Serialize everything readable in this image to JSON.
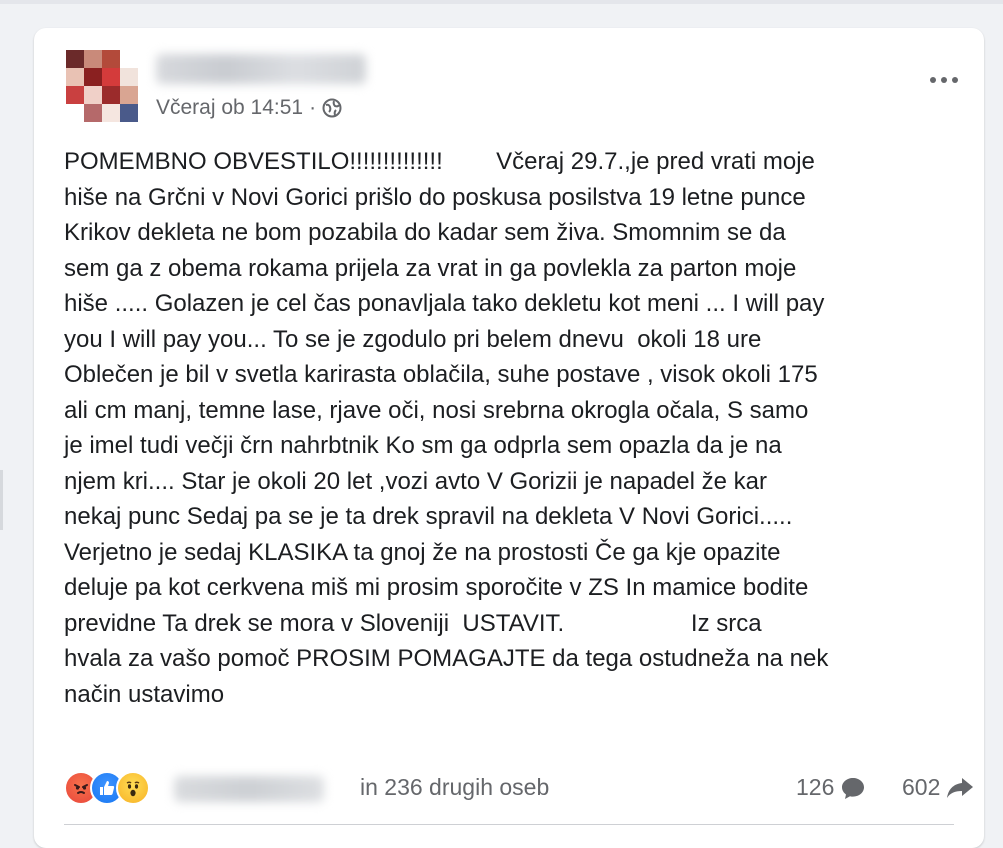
{
  "post": {
    "timestamp": "Včeraj ob 14:51",
    "separator": "·",
    "privacy_icon": "globe-icon",
    "more_icon": "more-options-icon",
    "text_lines": [
      "POMEMBNO OBVESTILO!!!!!!!!!!!!!!        Včeraj 29.7.,je pred vrati moje",
      "hiše na Grčni v Novi Gorici prišlo do poskusa posilstva 19 letne punce",
      "Krikov dekleta ne bom pozabila do kadar sem živa. Smomnim se da",
      "sem ga z obema rokama prijela za vrat in ga povlekla za parton moje",
      "hiše ..... Golazen je cel čas ponavljala tako dekletu kot meni ... I will pay",
      "you I will pay you... To se je zgodulo pri belem dnevu  okoli 18 ure",
      "Oblečen je bil v svetla karirasta oblačila, suhe postave , visok okoli 175",
      "ali cm manj, temne lase, rjave oči, nosi srebrna okrogla očala, S samo",
      "je imel tudi večji črn nahrbtnik Ko sm ga odprla sem opazla da je na",
      "njem kri.... Star je okoli 20 let ,vozi avto V Gorizii je napadel že kar",
      "nekaj punc Sedaj pa se je ta drek spravil na dekleta V Novi Gorici.....",
      "Verjetno je sedaj KLASIKA ta gnoj že na prostosti Če ga kje opazite",
      "deluje pa kot cerkvena miš mi prosim sporočite v ZS In mamice bodite",
      "previdne Ta drek se mora v Sloveniji  USTAVIT.                   Iz srca",
      "hvala za vašo pomoč PROSIM POMAGAJTE da tega ostudneža na nek",
      "način ustavimo"
    ]
  },
  "footer": {
    "reactions": [
      "angry-reaction-icon",
      "like-reaction-icon",
      "wow-reaction-icon"
    ],
    "reaction_text": "in 236 drugih oseb",
    "comments": "126",
    "comment_icon": "comment-icon",
    "shares": "602",
    "share_icon": "share-icon"
  },
  "colors": {
    "text": "#1c1e21",
    "secondary_text": "#65676b",
    "page_background": "#f0f2f5",
    "card_background": "#ffffff",
    "like_blue": "#1877f2",
    "angry_red": "#e9463b",
    "wow_yellow": "#f7b125"
  }
}
